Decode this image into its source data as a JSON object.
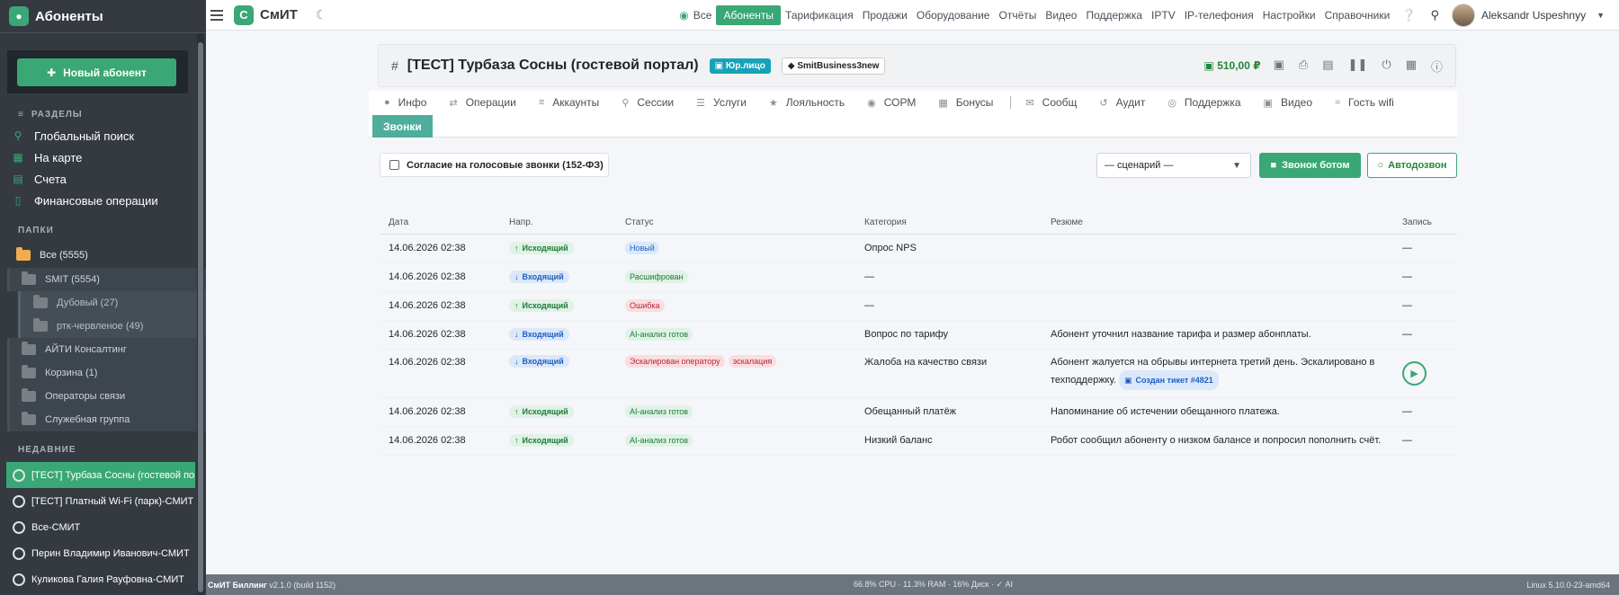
{
  "sidebar": {
    "brand": "Абоненты",
    "new_button": "Новый абонент",
    "sections_title": "РАЗДЕЛЫ",
    "nav": [
      {
        "label": "Глобальный поиск",
        "icon": "search-icon"
      },
      {
        "label": "На карте",
        "icon": "map-icon"
      },
      {
        "label": "Счета",
        "icon": "invoice-icon"
      },
      {
        "label": "Финансовые операции",
        "icon": "finance-icon"
      }
    ],
    "folders_title": "ПАПКИ",
    "folders": {
      "all": "Все (5555)",
      "smit": "SMIT (5554)",
      "dubovy": "Дубовый (27)",
      "rtk": "ртк-червленое (49)",
      "it": "АЙТИ Консалтинг",
      "trash": "Корзина (1)",
      "operators": "Операторы связи",
      "service": "Служебная группа"
    },
    "recent_title": "НЕДАВНИЕ",
    "recent": [
      "[ТЕСТ] Турбаза Сосны (гостевой портал)",
      "[ТЕСТ] Платный Wi-Fi (парк)-СМИТ",
      "Все-СМИТ",
      "Перин Владимир Иванович-СМИТ",
      "Куликова Галия Рауфовна-СМИТ"
    ]
  },
  "topbar": {
    "logo_letter": "С",
    "logo_text": "СмИТ",
    "menu": [
      "Все",
      "Абоненты",
      "Тарификация",
      "Продажи",
      "Оборудование",
      "Отчёты",
      "Видео",
      "Поддержка",
      "IPTV",
      "IP-телефония",
      "Настройки",
      "Справочники"
    ],
    "username": "Aleksandr Uspeshnyy"
  },
  "header": {
    "title": "[ТЕСТ] Турбаза Сосны (гостевой портал)",
    "badge_type": "Юр.лицо",
    "tag": "SmitBusiness3new",
    "balance": "510,00 ₽"
  },
  "tabs": {
    "items": [
      "Инфо",
      "Операции",
      "Аккаунты",
      "Сессии",
      "Услуги",
      "Лояльность",
      "СОРМ",
      "Бонусы",
      "Сообщ",
      "Аудит",
      "Поддержка",
      "Видео",
      "Гость wifi"
    ],
    "active": "Звонки"
  },
  "controls": {
    "consent_label": "Согласие на голосовые звонки (152-ФЗ)",
    "scenario_selected": "— сценарий —",
    "bot_call": "Звонок ботом",
    "autodial": "Автодозвон"
  },
  "table": {
    "headers": [
      "Дата",
      "Напр.",
      "Статус",
      "Категория",
      "Резюме",
      "Запись"
    ],
    "rows": [
      {
        "date": "14.06.2026 02:38",
        "dir": "Исходящий",
        "status": "Новый",
        "category": "Опрос NPS",
        "summary": "",
        "record": "—"
      },
      {
        "date": "14.06.2026 02:38",
        "dir": "Входящий",
        "status": "Расшифрован",
        "category": "—",
        "summary": "",
        "record": "—"
      },
      {
        "date": "14.06.2026 02:38",
        "dir": "Исходящий",
        "status": "Ошибка",
        "category": "—",
        "summary": "",
        "record": "—"
      },
      {
        "date": "14.06.2026 02:38",
        "dir": "Входящий",
        "status": "AI-анализ готов",
        "category": "Вопрос по тарифу",
        "summary": "Абонент уточнил название тарифа и размер абонплаты.",
        "record": "—"
      },
      {
        "date": "14.06.2026 02:38",
        "dir": "Входящий",
        "status": "Эскалирован оператору",
        "extra": "эскалация",
        "category": "Жалоба на качество связи",
        "summary": "Абонент жалуется на обрывы интернета третий день. Эскалировано в техподдержку.",
        "ticket": "Создан тикет #4821",
        "record": "play"
      },
      {
        "date": "14.06.2026 02:38",
        "dir": "Исходящий",
        "status": "AI-анализ готов",
        "category": "Обещанный платёж",
        "summary": "Напоминание об истечении обещанного платежа.",
        "record": "—"
      },
      {
        "date": "14.06.2026 02:38",
        "dir": "Исходящий",
        "status": "AI-анализ готов",
        "category": "Низкий баланс",
        "summary": "Робот сообщил абоненту о низком балансе и попросил пополнить счёт.",
        "record": "—"
      }
    ]
  },
  "footer": {
    "app": "СмИТ Биллинг",
    "version": "v2.1.0 (build 1152)",
    "stats": "66.8% CPU · 11.3% RAM · 16% Диск · ✓ AI",
    "kernel": "Linux 5.10.0-23-amd64"
  }
}
